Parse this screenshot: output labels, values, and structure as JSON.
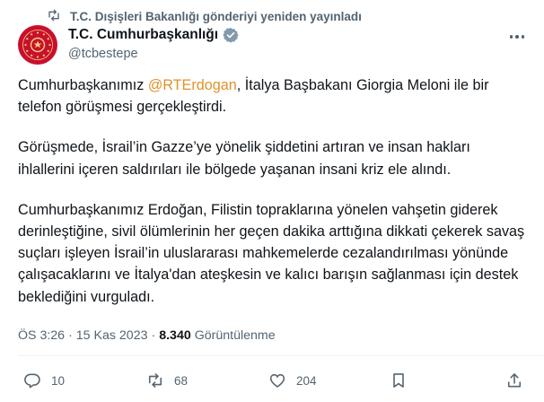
{
  "repost": {
    "text": "T.C. Dışişleri Bakanlığı gönderiyi yeniden yayınladı",
    "icon": "repost-icon"
  },
  "author": {
    "name": "T.C. Cumhurbaşkanlığı",
    "handle": "@tcbestepe",
    "verified_color": "#829aab",
    "avatar_color": "#c8102e"
  },
  "tweet": {
    "p1_before": "Cumhurbaşkanımız ",
    "p1_mention": "@RTErdogan",
    "p1_after": ", İtalya Başbakanı Giorgia Meloni ile bir telefon görüşmesi gerçekleştirdi.",
    "p2": "Görüşmede, İsrail’in Gazze’ye yönelik şiddetini artıran ve insan hakları ihlallerini içeren saldırıları ile bölgede yaşanan insani kriz ele alındı.",
    "p3": "Cumhurbaşkanımız Erdoğan, Filistin topraklarına yönelen vahşetin giderek derinleştiğine, sivil ölümlerinin her geçen dakika arttığına dikkati çekerek savaş suçları işleyen İsrail’in uluslararası mahkemelerde cezalandırılması yönünde çalışacaklarını ve İtalya'dan ateşkesin ve kalıcı barışın sağlanması için destek beklediğini vurguladı."
  },
  "meta": {
    "time": "ÖS 3:26",
    "date": "15 Kas 2023",
    "views": "8.340",
    "views_label": "Görüntülenme",
    "sep": "·"
  },
  "actions": {
    "replies": "10",
    "reposts": "68",
    "likes": "204"
  },
  "colors": {
    "mention": "#e0922c",
    "secondary": "#536471",
    "text": "#0f1419"
  }
}
